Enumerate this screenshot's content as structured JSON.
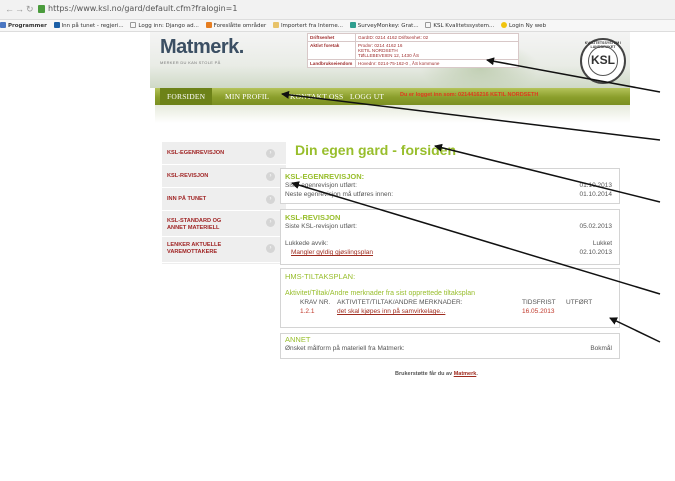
{
  "browser": {
    "url": "https://www.ksl.no/gard/default.cfm?fralogin=1",
    "bookmarks": [
      "Programmer",
      "Inn på tunet - regjeri...",
      "Logg inn: Django ad...",
      "Foreslåtte områder",
      "Importert fra Interne...",
      "SurveyMonkey: Grat...",
      "KSL Kvalitetssystem...",
      "Login Ny web"
    ]
  },
  "header": {
    "logo": "Matmerk.",
    "logo_tagline": "MERKER DU KAN STOLE PÅ",
    "info": [
      {
        "label": "Driftsenhet",
        "value": "GardID: 0214 4162 Driftsenhet: 02"
      },
      {
        "label": "Aktivt foretak",
        "value": "Prodnr: 0214 4162 16\nKETIL NORDSETH\nTØLLEBEVEIEN 12, 1430 ÅS"
      },
      {
        "label": "Landbrukseiendom",
        "value": "Hovednr: 0214-75-162-0 , ÅS kommune"
      }
    ],
    "seal_text": "KSL",
    "seal_ring": "KVALITETSSYSTEM I LANDBRUKET"
  },
  "nav": {
    "items": [
      "FORSIDEN",
      "MIN PROFIL",
      "KONTAKT OSS",
      "LOGG UT"
    ],
    "logged_in": "Du er logget inn som: 0214416216 KETIL NORDSETH"
  },
  "sidebar": {
    "items": [
      {
        "label": "KSL-EGENREVISJON"
      },
      {
        "label": "KSL-REVISJON"
      },
      {
        "label": "INN PÅ TUNET"
      },
      {
        "label": "KSL-STANDARD OG\nANNET MATERIELL"
      },
      {
        "label": "LENKER AKTUELLE\nVAREMOTTAKERE"
      }
    ]
  },
  "main": {
    "title": "Din egen gard - forsiden",
    "egen": {
      "heading": "KSL-EGENREVISJON:",
      "row1_label": "Siste egenrevisjon utført:",
      "row1_value": "01.10.2013",
      "row2_label": "Neste egenrevisjon må utføres innen:",
      "row2_value": "01.10.2014"
    },
    "revisjon": {
      "heading": "KSL-REVISJON",
      "row1_label": "Siste KSL-revisjon utført:",
      "row1_value": "05.02.2013",
      "avvik_label": "Lukkede avvik:",
      "avvik_status": "Lukket",
      "avvik_link": "Mangler gyldig gjøslingsplan",
      "avvik_date": "02.10.2013"
    },
    "hms": {
      "heading": "HMS-TILTAKSPLAN:",
      "subheading": "Aktivitet/Tiltak/Andre merknader fra sist opprettede tiltaksplan",
      "col_krav": "KRAV NR.",
      "col_tiltak": "AKTIVITET/TILTAK/ANDRE MERKNADER:",
      "col_frist": "TIDSFRIST",
      "col_utfort": "UTFØRT",
      "row_krav": "1.2.1",
      "row_tiltak": "det skal kjøpes inn på samvirkelage...",
      "row_frist": "16.05.2013"
    },
    "annet": {
      "heading": "ANNET",
      "label": "Ønsket målform på materiell fra Matmerk:",
      "value": "Bokmål"
    },
    "footer_text": "Brukerstøtte får du av",
    "footer_link": "Matmerk",
    "footer_dot": "."
  },
  "colors": {
    "accent_green": "#98be2c",
    "nav_green": "#8a9e2b",
    "link_red": "#9e2b1e"
  }
}
